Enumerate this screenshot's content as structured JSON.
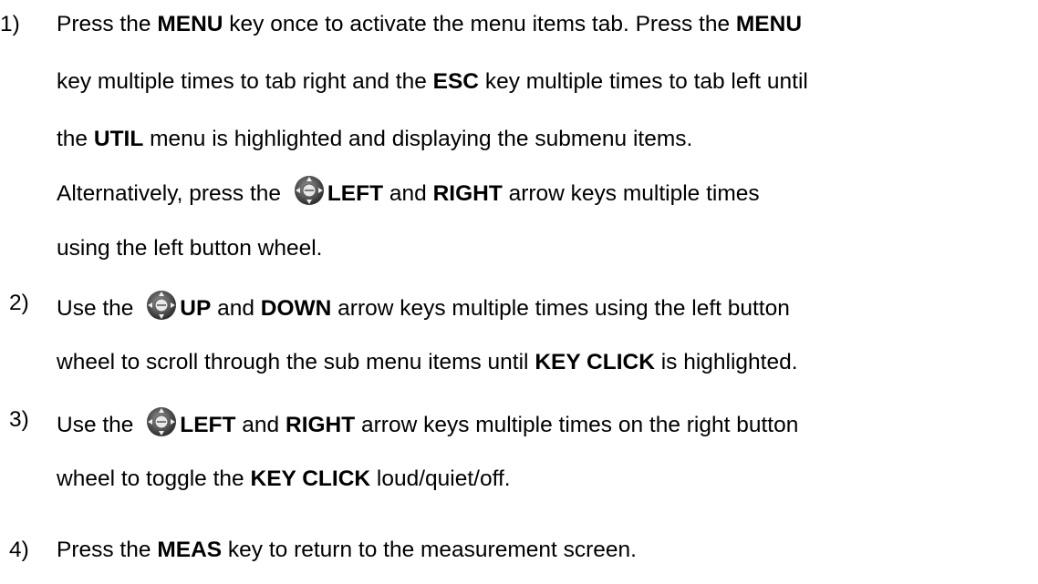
{
  "steps": [
    {
      "number": "1)",
      "lines": [
        {
          "t1": "Press the ",
          "b1": "MENU",
          "t2": " key once to activate the menu items tab.  Press the ",
          "b2": "MENU"
        },
        {
          "t1": "key multiple times to tab right and the ",
          "b1": "ESC",
          "t2": " key multiple times to tab left until"
        },
        {
          "t1": "the ",
          "b1": "UTIL",
          "t2": " menu is highlighted and displaying the submenu items."
        },
        {
          "t1": "Alternatively, press the ",
          "b1": "LEFT",
          "t2": " and ",
          "b2": "RIGHT",
          "t3": " arrow keys multiple times"
        },
        {
          "t1": "using the left button wheel."
        }
      ]
    },
    {
      "number": "2)",
      "lines": [
        {
          "t1": "Use the ",
          "b1": "UP",
          "t2": " and ",
          "b2": "DOWN",
          "t3": " arrow keys multiple times using the left button"
        },
        {
          "t1": "wheel to scroll through the sub menu items until ",
          "b1": "KEY CLICK",
          "t2": " is highlighted."
        }
      ]
    },
    {
      "number": "3)",
      "lines": [
        {
          "t1": "Use the ",
          "b1": "LEFT",
          "t2": " and ",
          "b2": "RIGHT",
          "t3": " arrow keys multiple times on the right button"
        },
        {
          "t1": "wheel to toggle the ",
          "b1": "KEY CLICK",
          "t2": " loud/quiet/off."
        }
      ]
    },
    {
      "number": "4)",
      "lines": [
        {
          "t1": "Press the ",
          "b1": "MEAS",
          "t2": " key to return to the measurement screen."
        }
      ]
    }
  ],
  "icons": {
    "wheel_icon": "arrow-button-wheel-icon"
  }
}
